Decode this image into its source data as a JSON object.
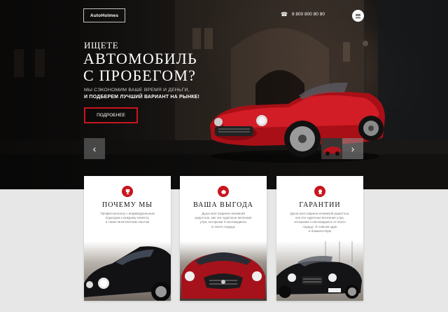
{
  "header": {
    "logo": "AutoHolmes",
    "phone_icon": "phone-icon",
    "phone": "8 800 800 80 80",
    "menu_icon": "hamburger-icon"
  },
  "hero": {
    "kicker": "ИЩЕТЕ",
    "title_line1": "АВТОМОБИЛЬ",
    "title_line2": "С ПРОБЕГОМ?",
    "subtitle_line1": "МЫ СЭКОНОМИМ ВАШЕ ВРЕМЯ И ДЕНЬГИ,",
    "subtitle_line2": "И ПОДБЕРЕМ ЛУЧШИЙ ВАРИАНТ НА РЫНКЕ!",
    "cta": "ПОДРОБНЕЕ",
    "prev_arrow": "‹",
    "next_arrow": "›"
  },
  "cards": [
    {
      "title": "ПОЧЕМУ МЫ",
      "text": [
        "Профессионалы с индивидуальным",
        "подходом к каждому клиенту,",
        "а также многолетним опытом"
      ]
    },
    {
      "title": "ВАША ВЫГОДА",
      "text": [
        "Душа моя озарена неземной",
        "радостью, как эти чудесные весенние",
        "утра, которыми я наслаждаюсь",
        "от всего сердца."
      ]
    },
    {
      "title": "ГАРАНТИИ",
      "text": [
        "Душа моя озарена неземной радостью,",
        "как эти чудесные весенние утра,",
        "которыми я наслаждаюсь от всего",
        "сердца. Я совсем один",
        "и блаженствую"
      ]
    }
  ],
  "colors": {
    "accent": "#c9151e",
    "hero_dark": "#1e1b19",
    "page_bg": "#e7e7e7"
  }
}
